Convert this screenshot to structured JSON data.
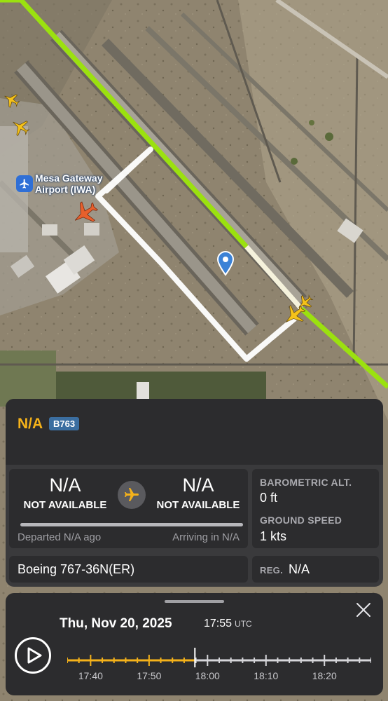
{
  "map": {
    "airport_label_line1": "Mesa Gateway",
    "airport_label_line2": "Airport (IWA)",
    "icons": [
      "airport-icon",
      "location-pin-icon",
      "aircraft-orange-icon",
      "aircraft-yellow-icon"
    ]
  },
  "flight": {
    "callsign": "N/A",
    "type_code": "B763",
    "origin_code": "N/A",
    "origin_status": "NOT AVAILABLE",
    "destination_code": "N/A",
    "destination_status": "NOT AVAILABLE",
    "departed_text": "Departed N/A ago",
    "arriving_text": "Arriving in N/A",
    "progress": 0,
    "aircraft_model": "Boeing 767-36N(ER)",
    "baro_alt_label": "BAROMETRIC ALT.",
    "baro_alt_value": "0 ft",
    "ground_speed_label": "GROUND SPEED",
    "ground_speed_value": "1 kts",
    "reg_label": "REG.",
    "reg_value": "N/A"
  },
  "timeline": {
    "date": "Thu, Nov 20, 2025",
    "time": "17:55",
    "tz": "UTC",
    "tick_labels": [
      "17:40",
      "17:50",
      "18:00",
      "18:10",
      "18:20"
    ],
    "playhead_fraction": 0.42
  },
  "colors": {
    "accent_yellow": "#f5b21a",
    "track_green": "#9be10f",
    "badge_blue": "#3b6ea0",
    "panel_bg": "#2c2c2e"
  }
}
